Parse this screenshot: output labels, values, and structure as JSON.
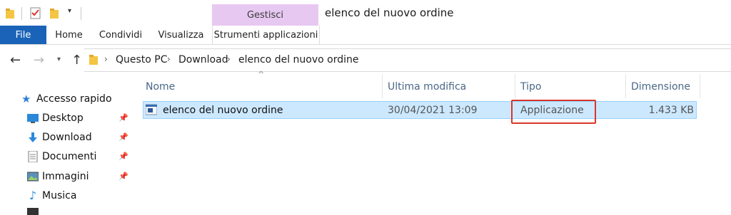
{
  "window": {
    "title": "elenco del nuovo ordine",
    "context_group": "Gestisci"
  },
  "ribbon": {
    "tabs": [
      "File",
      "Home",
      "Condividi",
      "Visualizza",
      "Strumenti applicazioni"
    ],
    "active_tab": "Strumenti applicazioni"
  },
  "address_bar": {
    "path": [
      "Questo PC",
      "Download",
      "elenco del nuovo ordine"
    ]
  },
  "sidebar": {
    "quick_access_label": "Accesso rapido",
    "items": [
      {
        "label": "Desktop",
        "icon": "desktop-icon",
        "pinned": true
      },
      {
        "label": "Download",
        "icon": "download-icon",
        "pinned": true
      },
      {
        "label": "Documenti",
        "icon": "documents-icon",
        "pinned": true
      },
      {
        "label": "Immagini",
        "icon": "pictures-icon",
        "pinned": true
      },
      {
        "label": "Musica",
        "icon": "music-icon",
        "pinned": false
      }
    ]
  },
  "file_list": {
    "columns": [
      "Nome",
      "Ultima modifica",
      "Tipo",
      "Dimensione"
    ],
    "rows": [
      {
        "name": "elenco del nuovo ordine",
        "modified": "30/04/2021 13:09",
        "type": "Applicazione",
        "size": "1.433 KB",
        "selected": true
      }
    ]
  },
  "colors": {
    "file_tab": "#1a63b8",
    "context_tab": "#e7c8f1",
    "selection": "#cce8ff",
    "highlight_box": "#d9372a"
  }
}
